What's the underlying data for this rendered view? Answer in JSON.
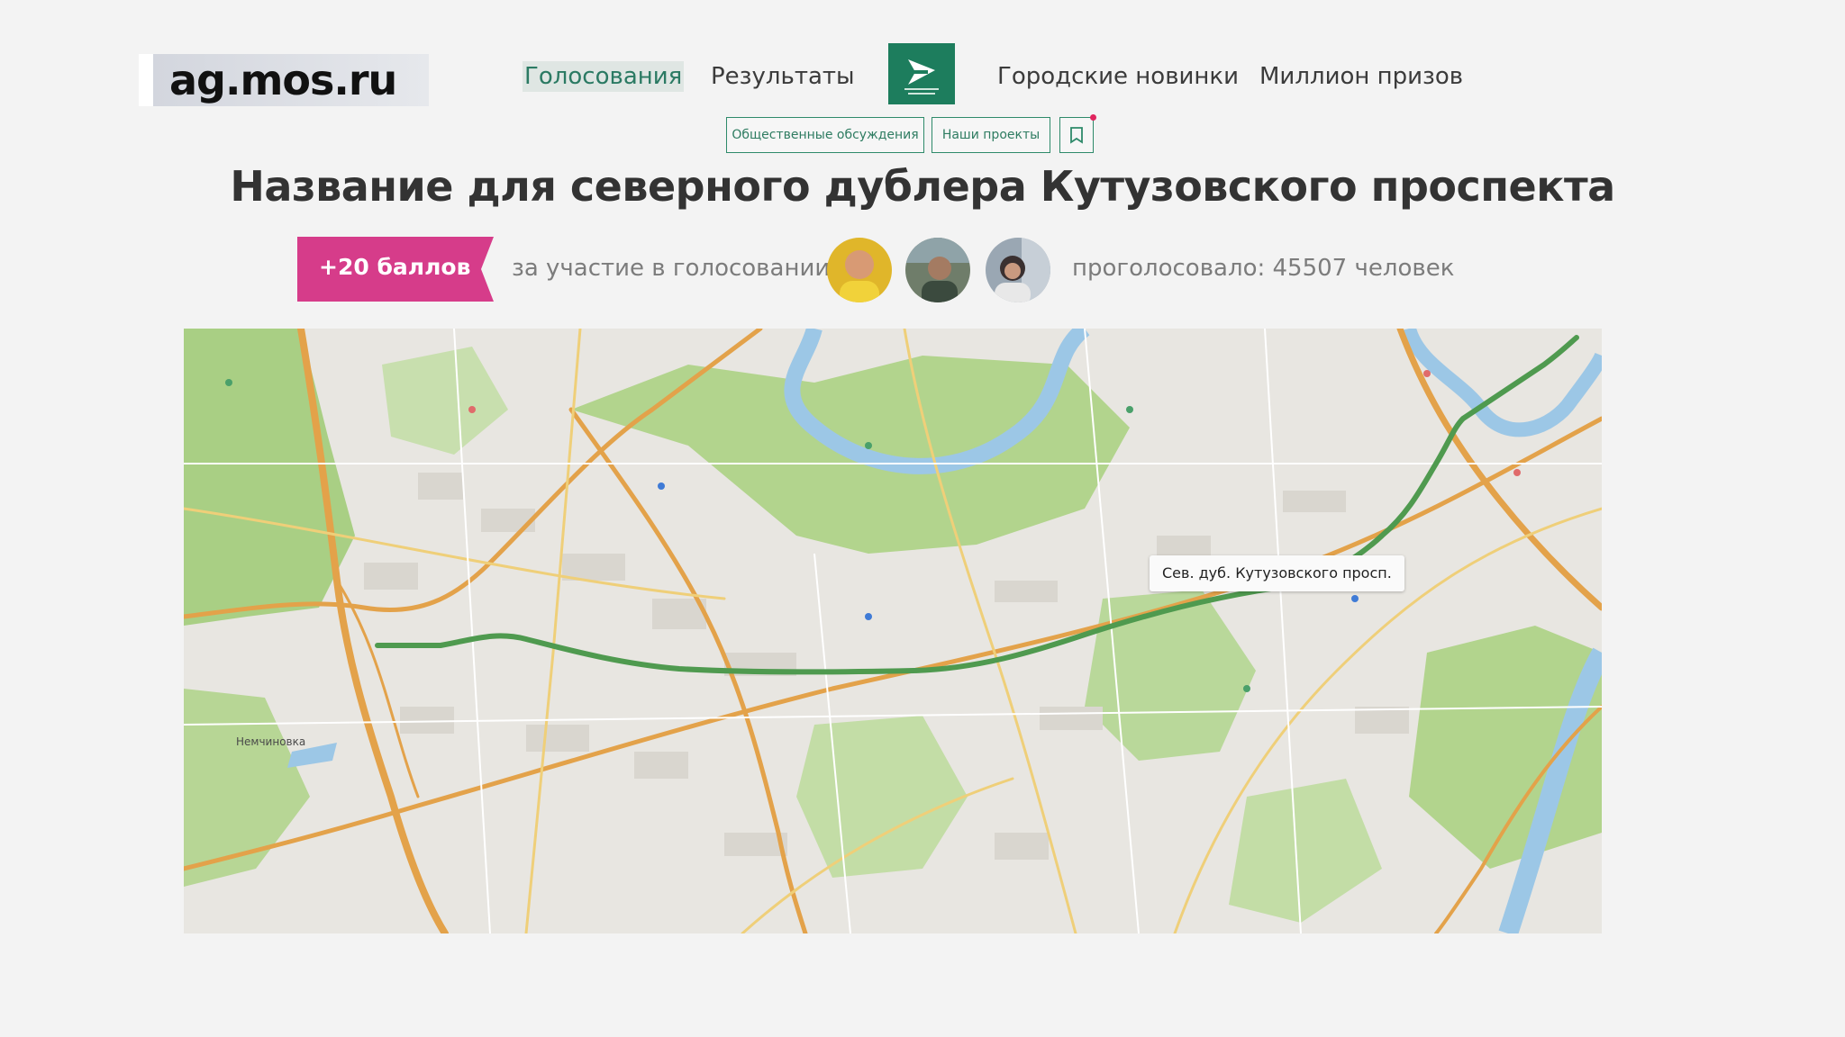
{
  "site": {
    "url": "ag.mos.ru"
  },
  "nav": {
    "items": [
      {
        "label": "Голосования",
        "active": true
      },
      {
        "label": "Результаты",
        "active": false
      },
      {
        "label": "Городские новинки",
        "active": false
      },
      {
        "label": "Миллион призов",
        "active": false
      }
    ],
    "logo_icon": "active-citizen-logo-icon"
  },
  "subnav": {
    "discussions_label": "Общественные обсуждения",
    "projects_label": "Наши проекты",
    "bookmark_icon": "bookmark-icon"
  },
  "poll": {
    "title": "Название для северного дублера Кутузовского проспекта",
    "points_label": "+20 баллов",
    "points_note": "за участие в голосовании",
    "voted_label": "проголосовало: 45507 человек"
  },
  "map": {
    "route_label": "Сев. дуб. Кутузовского просп.",
    "place_label": "Немчиновка",
    "route_color": "#4f9a4f"
  },
  "colors": {
    "accent_green": "#1d7d5d",
    "badge_pink": "#d63c8a",
    "background": "#f3f3f3"
  }
}
